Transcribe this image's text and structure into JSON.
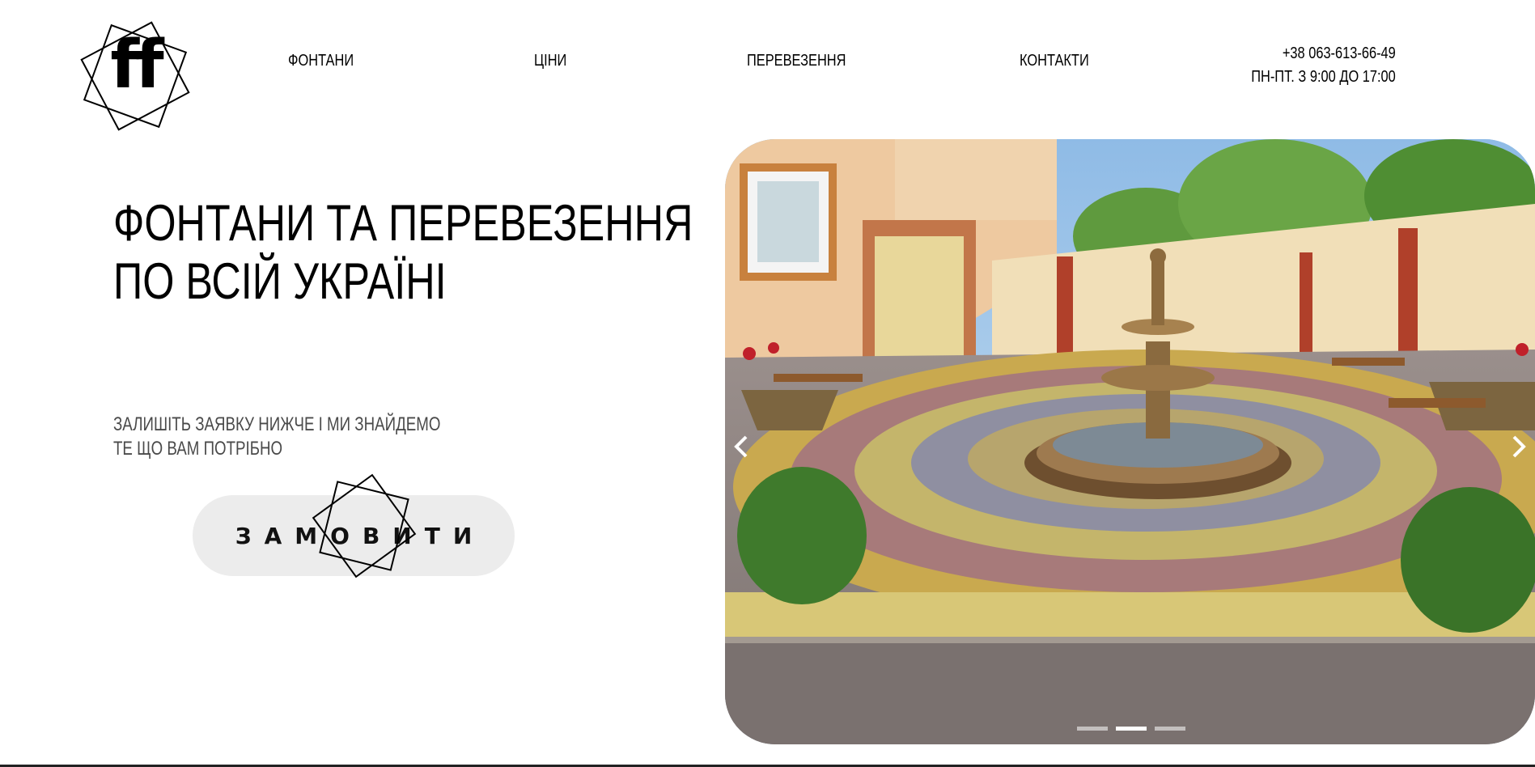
{
  "logo": {
    "text": "ff"
  },
  "nav": {
    "items": [
      {
        "label": "ФОНТАНИ"
      },
      {
        "label": "ЦІНИ"
      },
      {
        "label": "ПЕРЕВЕЗЕННЯ"
      },
      {
        "label": "КОНТАКТИ"
      }
    ]
  },
  "contact": {
    "phone": "+38 063-613-66-49",
    "hours": "ПН-ПТ. З 9:00 ДО 17:00"
  },
  "hero": {
    "title_line1": "ФОНТАНИ ТА ПЕРЕВЕЗЕННЯ",
    "title_line2": "ПО ВСІЙ УКРАЇНІ",
    "subtitle_line1": "ЗАЛИШІТЬ ЗАЯВКУ НИЖЧЕ І МИ ЗНАЙДЕМО",
    "subtitle_line2": "ТЕ ЩО ВАМ ПОТРІБНО",
    "cta_label": "ЗАМОВИТИ"
  },
  "slider": {
    "image": "courtyard fountain photo",
    "prev_icon": "chevron-left-icon",
    "next_icon": "chevron-right-icon",
    "slide_count": 3,
    "active_slide": 2
  },
  "colors": {
    "button_bg": "#ececec",
    "subtitle": "#4a4a4a",
    "text": "#000000"
  }
}
